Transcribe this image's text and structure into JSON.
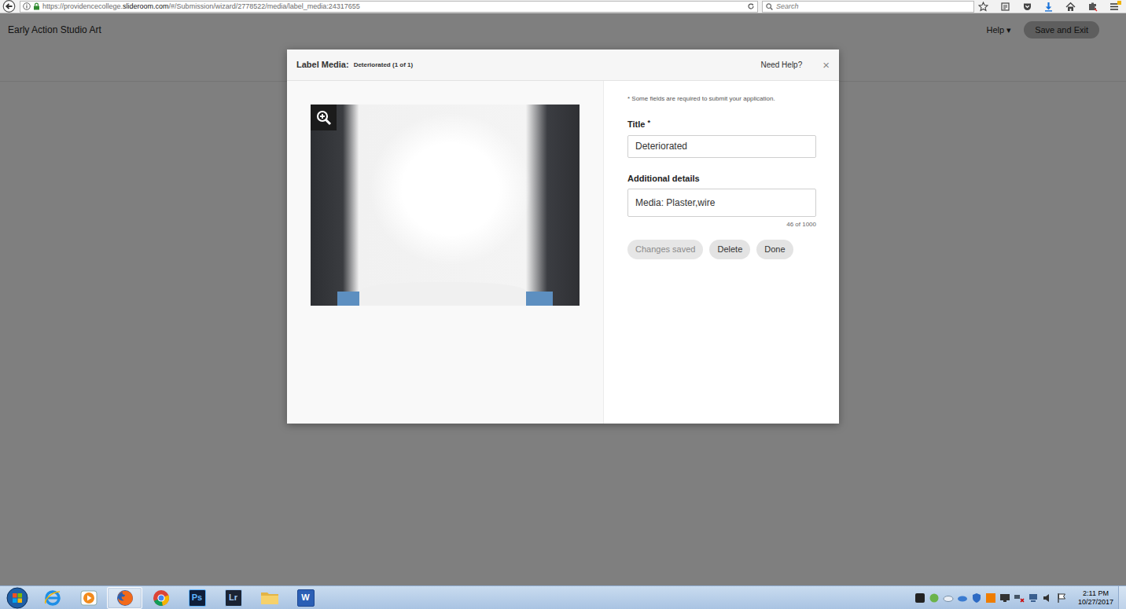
{
  "browser": {
    "url_prefix": "https://providencecollege.",
    "url_domain": "slideroom.com",
    "url_rest": "/#/Submission/wizard/2778522/media/label_media:24317655",
    "search_placeholder": "Search"
  },
  "page": {
    "title": "Early Action Studio Art",
    "help": "Help",
    "help_caret": "▾",
    "save_exit": "Save and Exit"
  },
  "modal": {
    "label": "Label Media:",
    "subtitle": "Deteriorated (1 of 1)",
    "need_help": "Need Help?",
    "close": "×",
    "note": "* Some fields are required to submit your application.",
    "fields": [
      {
        "label": "Title",
        "required": true,
        "required_mark": "*",
        "value": "Deteriorated"
      },
      {
        "label": "Additional details",
        "required": false,
        "value": "Media: Plaster,wire",
        "counter": "46 of 1000"
      }
    ],
    "buttons": [
      {
        "label": "Changes saved",
        "disabled": true
      },
      {
        "label": "Delete",
        "disabled": false
      },
      {
        "label": "Done",
        "disabled": false
      }
    ]
  },
  "taskbar": {
    "apps": [
      {
        "kind": "ie",
        "selected": false
      },
      {
        "kind": "media",
        "selected": false
      },
      {
        "kind": "firefox",
        "selected": true
      },
      {
        "kind": "chrome",
        "selected": false
      },
      {
        "kind": "ps",
        "text": "Ps",
        "selected": false
      },
      {
        "kind": "lr",
        "text": "Lr",
        "selected": false
      },
      {
        "kind": "folder",
        "selected": false
      },
      {
        "kind": "word",
        "text": "W",
        "selected": false
      }
    ],
    "time": "2:11 PM",
    "date": "10/27/2017"
  }
}
